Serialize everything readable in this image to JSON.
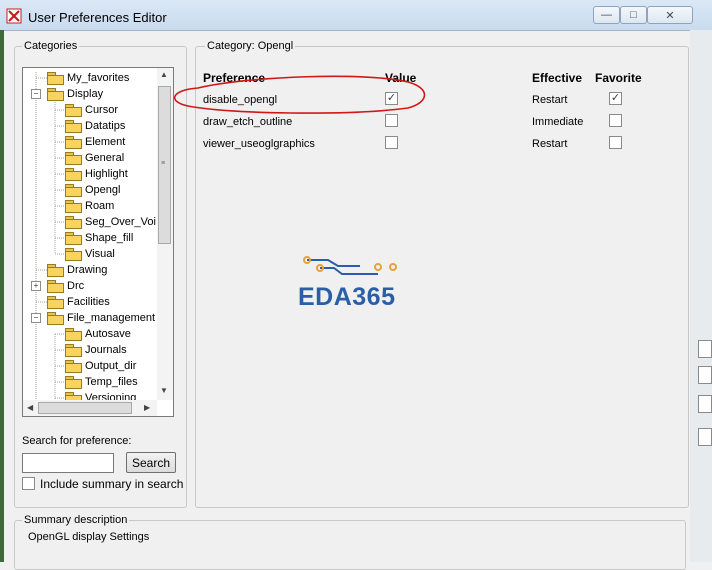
{
  "window": {
    "title": "User Preferences Editor"
  },
  "categories": {
    "heading": "Categories",
    "tree": [
      {
        "label": "My_favorites",
        "level": 1
      },
      {
        "label": "Display",
        "level": 0,
        "expanded": true
      },
      {
        "label": "Cursor",
        "level": 2
      },
      {
        "label": "Datatips",
        "level": 2
      },
      {
        "label": "Element",
        "level": 2
      },
      {
        "label": "General",
        "level": 2
      },
      {
        "label": "Highlight",
        "level": 2
      },
      {
        "label": "Opengl",
        "level": 2,
        "selected": true
      },
      {
        "label": "Roam",
        "level": 2
      },
      {
        "label": "Seg_Over_Voi",
        "level": 2
      },
      {
        "label": "Shape_fill",
        "level": 2
      },
      {
        "label": "Visual",
        "level": 2
      },
      {
        "label": "Drawing",
        "level": 1
      },
      {
        "label": "Drc",
        "level": 0,
        "expanded": false
      },
      {
        "label": "Facilities",
        "level": 1
      },
      {
        "label": "File_management",
        "level": 0,
        "expanded": true
      },
      {
        "label": "Autosave",
        "level": 2
      },
      {
        "label": "Journals",
        "level": 2
      },
      {
        "label": "Output_dir",
        "level": 2
      },
      {
        "label": "Temp_files",
        "level": 2
      },
      {
        "label": "Versioning",
        "level": 2
      }
    ]
  },
  "search": {
    "label": "Search for preference:",
    "value": "",
    "button": "Search",
    "include_summary_label": "Include summary in search",
    "include_summary_checked": false
  },
  "category_panel": {
    "heading": "Category:  Opengl",
    "columns": {
      "preference": "Preference",
      "value": "Value",
      "effective": "Effective",
      "favorite": "Favorite"
    },
    "rows": [
      {
        "preference": "disable_opengl",
        "value": true,
        "effective": "Restart",
        "favorite": true
      },
      {
        "preference": "draw_etch_outline",
        "value": false,
        "effective": "Immediate",
        "favorite": false
      },
      {
        "preference": "viewer_useoglgraphics",
        "value": false,
        "effective": "Restart",
        "favorite": false
      }
    ]
  },
  "watermark": {
    "text": "EDA365",
    "color": "#2a5fa8",
    "accent": "#e8a23a"
  },
  "summary": {
    "heading": "Summary description",
    "text": "OpenGL display Settings"
  },
  "annotation": {
    "color": "#d01818"
  }
}
